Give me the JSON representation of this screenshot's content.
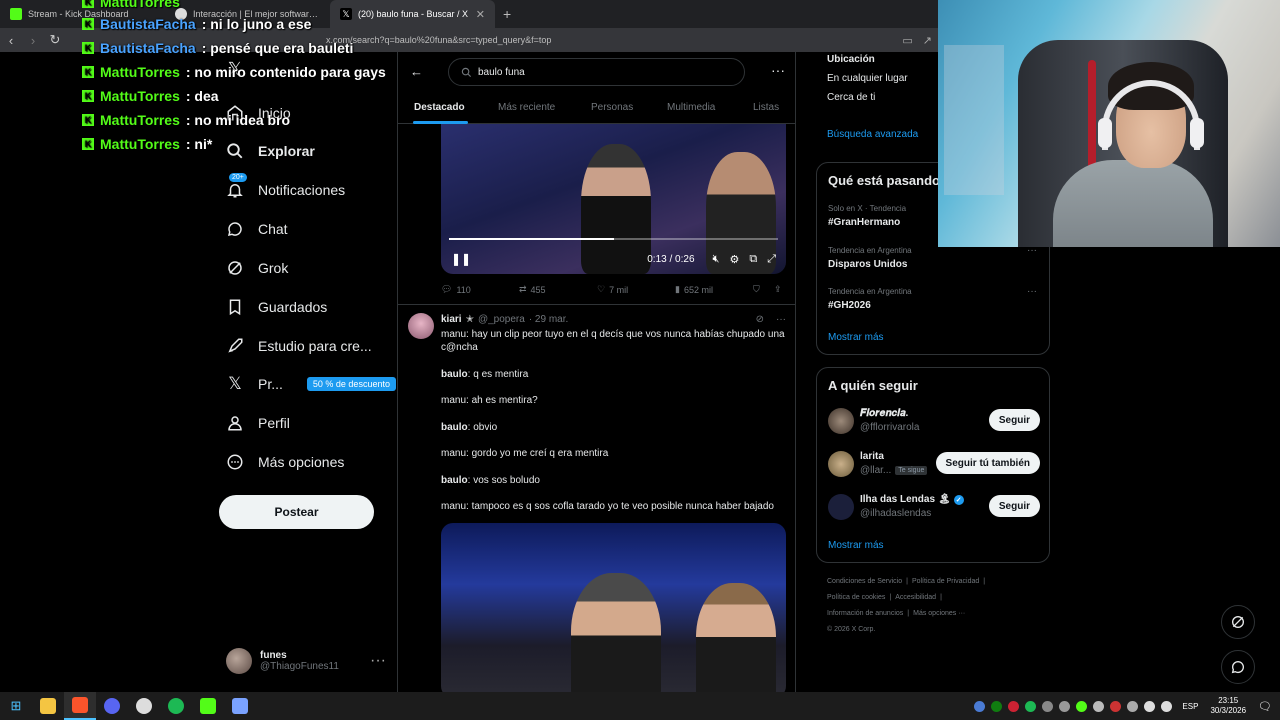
{
  "browser": {
    "tabs": [
      {
        "title": "Stream - Kick Dashboard"
      },
      {
        "title": "Interacción | El mejor software para g"
      },
      {
        "title": "(20) baulo funa - Buscar / X"
      }
    ],
    "url": "x.com/search?q=baulo%20funa&src=typed_query&f=top"
  },
  "chat": [
    {
      "user": "MattuTorres",
      "msg": "",
      "color": "green"
    },
    {
      "user": "BautistaFacha",
      "msg": ": ni lo juno a ese",
      "color": "blue"
    },
    {
      "user": "BautistaFacha",
      "msg": ": pensé que era bauleti",
      "color": "blue"
    },
    {
      "user": "MattuTorres",
      "msg": ": no miro contenido para gays",
      "color": "green"
    },
    {
      "user": "MattuTorres",
      "msg": ": dea",
      "color": "green"
    },
    {
      "user": "MattuTorres",
      "msg": ": no mi idea bro",
      "color": "green"
    },
    {
      "user": "MattuTorres",
      "msg": ": ni*",
      "color": "green"
    }
  ],
  "nav": {
    "items": [
      {
        "label": "Inicio"
      },
      {
        "label": "Explorar"
      },
      {
        "label": "Notificaciones",
        "badge": "20+"
      },
      {
        "label": "Chat"
      },
      {
        "label": "Grok"
      },
      {
        "label": "Guardados"
      },
      {
        "label": "Estudio para cre..."
      },
      {
        "label": "Pr...",
        "promo": "50 % de descuento"
      },
      {
        "label": "Perfil"
      },
      {
        "label": "Más opciones"
      }
    ],
    "post_button": "Postear",
    "account": {
      "name": "funes",
      "handle": "@ThiagoFunes11"
    }
  },
  "search": {
    "query": "baulo funa",
    "tabs": [
      "Destacado",
      "Más reciente",
      "Personas",
      "Multimedia",
      "Listas"
    ]
  },
  "tweet1": {
    "video": {
      "time": "0:13 / 0:26",
      "progress": 0.5
    },
    "actions": {
      "replies": "110",
      "retweets": "455",
      "likes": "7 mil",
      "views": "652 mil"
    }
  },
  "tweet2": {
    "name": "kiari",
    "handle": "@_popera",
    "date": "· 29 mar.",
    "lines": [
      {
        "speaker": "",
        "text": "manu: hay un clip peor tuyo en el q decís que vos nunca habías chupado una c@ncha"
      },
      {
        "speaker": "baulo",
        "text": ": q es mentira"
      },
      {
        "speaker": "",
        "text": "manu: ah es mentira?"
      },
      {
        "speaker": "baulo",
        "text": ": obvio"
      },
      {
        "speaker": "",
        "text": "manu: gordo yo me creí q era mentira"
      },
      {
        "speaker": "baulo",
        "text": ": vos sos boludo"
      },
      {
        "speaker": "",
        "text": "manu: tampoco es q sos cofla tarado yo te veo posible nunca haber bajado"
      }
    ]
  },
  "right": {
    "location_title": "Ubicación",
    "location_options": [
      "En cualquier lugar",
      "Cerca de ti"
    ],
    "advanced_search": "Búsqueda avanzada",
    "trends_title": "Qué está pasando",
    "trends": [
      {
        "meta": "Solo en X · Tendencia",
        "name": "#GranHermano"
      },
      {
        "meta": "Tendencia en Argentina",
        "name": "Disparos Unidos"
      },
      {
        "meta": "Tendencia en Argentina",
        "name": "#GH2026"
      }
    ],
    "show_more": "Mostrar más",
    "follow_title": "A quién seguir",
    "follow": [
      {
        "name": "𝑭𝒍𝒐𝒓𝒆𝒏𝒄𝒊𝒂.",
        "handle": "@fflorrivarola",
        "button": "Seguir"
      },
      {
        "name": "larita",
        "handle": "@llar...",
        "chip": "Te sigue",
        "button": "Seguir tú también"
      },
      {
        "name": "Ilha das Lendas",
        "handle": "@ilhadaslendas",
        "button": "Seguir"
      }
    ],
    "follow_more": "Mostrar más",
    "footer": [
      "Condiciones de Servicio",
      "|",
      "Política de Privacidad",
      "|",
      "Política de cookies",
      "|",
      "Accesibilidad",
      "|",
      "Información de anuncios",
      "|",
      "Más opciones ···",
      "© 2026 X Corp."
    ]
  },
  "taskbar": {
    "lang": "ESP",
    "time": "23:15",
    "date": "30/3/2026"
  },
  "colors": {
    "accent": "#1d9bf0",
    "kick": "#53fc18",
    "bg": "#000000"
  }
}
